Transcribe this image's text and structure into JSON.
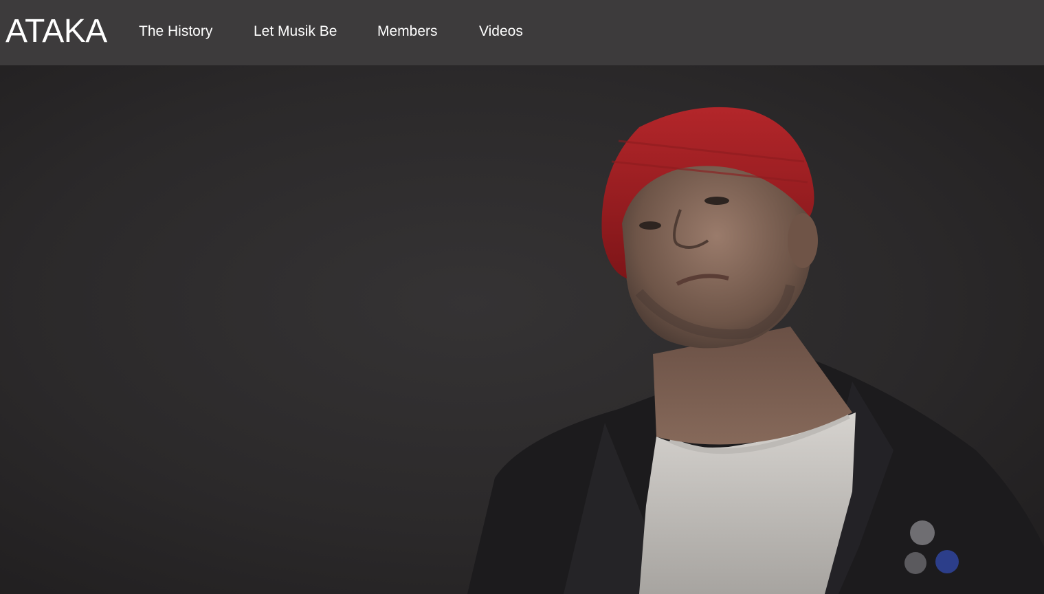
{
  "header": {
    "brand": "ATAKA",
    "nav": [
      {
        "label": "The History"
      },
      {
        "label": "Let Musik Be"
      },
      {
        "label": "Members"
      },
      {
        "label": "Videos"
      }
    ]
  },
  "hero": {
    "subject": "portrait-photo",
    "colors": {
      "background": "#2a2829",
      "beanie": "#9b1c1d",
      "jacket": "#1d1c1e",
      "tshirt": "#c9c6c2",
      "skin": "#8a6c5c"
    }
  }
}
